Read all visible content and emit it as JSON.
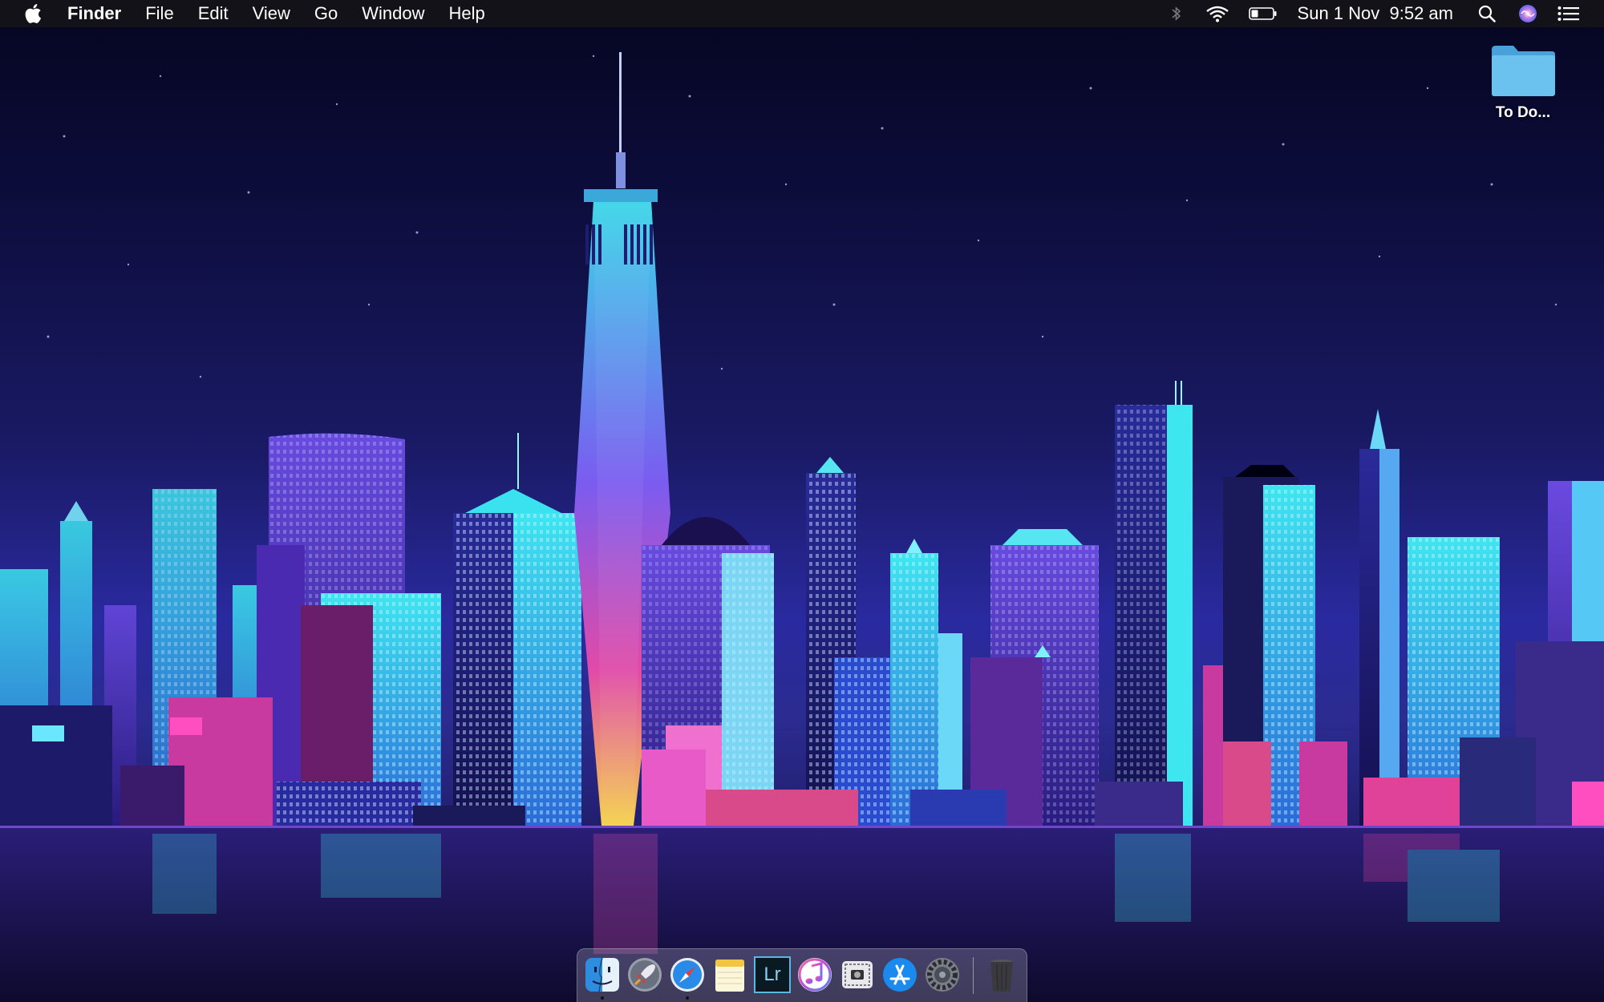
{
  "menubar": {
    "apple_icon": "apple-logo-icon",
    "items": [
      "Finder",
      "File",
      "Edit",
      "View",
      "Go",
      "Window",
      "Help"
    ],
    "status": {
      "bluetooth_icon": "bluetooth-icon",
      "wifi_icon": "wifi-icon",
      "battery_icon": "battery-icon",
      "date": "Sun 1 Nov",
      "time": "9:52 am",
      "spotlight_icon": "magnifier-icon",
      "siri_icon": "siri-icon",
      "notifications_icon": "list-icon"
    }
  },
  "desktop": {
    "items": [
      {
        "label": "To Do...",
        "icon": "folder-icon"
      }
    ]
  },
  "dock": {
    "apps": [
      {
        "name": "Finder",
        "icon": "finder-icon",
        "running": true
      },
      {
        "name": "Launchpad",
        "icon": "rocket-icon",
        "running": false
      },
      {
        "name": "Safari",
        "icon": "compass-icon",
        "running": true
      },
      {
        "name": "Notes",
        "icon": "notes-icon",
        "running": false
      },
      {
        "name": "Lightroom",
        "icon": "lr-icon",
        "label": "Lr",
        "running": false
      },
      {
        "name": "iTunes",
        "icon": "music-note-icon",
        "running": false
      },
      {
        "name": "Screenshot",
        "icon": "screenshot-icon",
        "running": false
      },
      {
        "name": "App Store",
        "icon": "app-store-icon",
        "running": false
      },
      {
        "name": "System Preferences",
        "icon": "gear-icon",
        "running": false
      }
    ],
    "trash_icon": "trash-icon"
  },
  "colors": {
    "menubar_bg": "#141418",
    "folder_blue": "#5ab4e6",
    "wallpaper_top": "#050520",
    "wallpaper_horizon": "#2a2aa0"
  }
}
